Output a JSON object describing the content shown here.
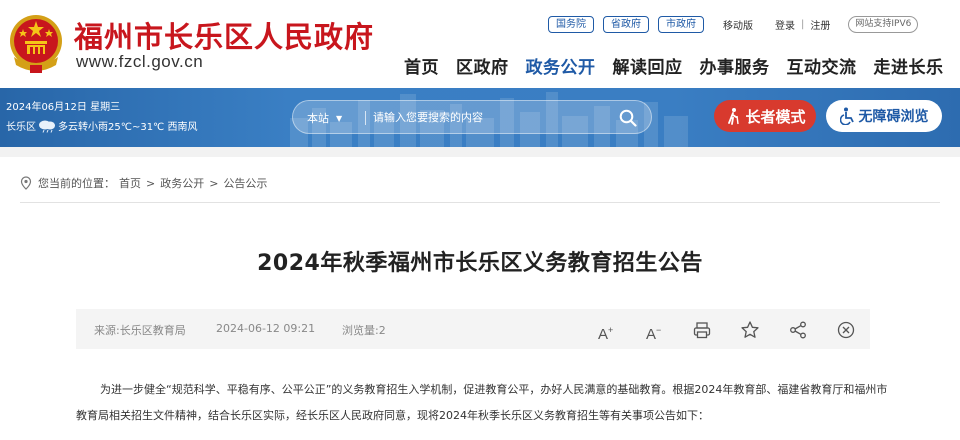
{
  "header": {
    "site_title": "福州市长乐区人民政府",
    "site_domain": "www.fzcl.gov.cn",
    "top_links": [
      "国务院",
      "省政府",
      "市政府"
    ],
    "mobile_label": "移动版",
    "login_label": "登录",
    "separator": "|",
    "register_label": "注册",
    "ipv6_badge": "网站支持IPV6",
    "nav": [
      {
        "label": "首页",
        "active": false
      },
      {
        "label": "区政府",
        "active": false
      },
      {
        "label": "政务公开",
        "active": true
      },
      {
        "label": "解读回应",
        "active": false
      },
      {
        "label": "办事服务",
        "active": false
      },
      {
        "label": "互动交流",
        "active": false
      },
      {
        "label": "走进长乐",
        "active": false
      }
    ]
  },
  "banner": {
    "date": "2024年06月12日 星期三",
    "district": "长乐区",
    "weather_icon": "cloud-rain-icon",
    "weather": "多云转小雨25℃~31℃ 西南风",
    "search_scope": "本站",
    "search_placeholder": "请输入您要搜索的内容",
    "elder_mode_label": "长者模式",
    "accessibility_label": "无障碍浏览"
  },
  "breadcrumb": {
    "prefix": "您当前的位置：",
    "items": [
      "首页",
      "政务公开",
      "公告公示"
    ],
    "separator": ">"
  },
  "article": {
    "title": "2024年秋季福州市长乐区义务教育招生公告",
    "source": "来源:长乐区教育局",
    "date": "2024-06-12 09:21",
    "views": "浏览量:2",
    "tools": [
      "font-increase-icon",
      "font-decrease-icon",
      "print-icon",
      "favorite-star-icon",
      "share-icon",
      "close-icon"
    ],
    "body": "为进一步健全“规范科学、平稳有序、公平公正”的义务教育招生入学机制，促进教育公平，办好人民满意的基础教育。根据2024年教育部、福建省教育厅和福州市教育局相关招生文件精神，结合长乐区实际，经长乐区人民政府同意，现将2024年秋季长乐区义务教育招生等有关事项公告如下："
  },
  "colors": {
    "brand_red": "#c8161d",
    "nav_blue": "#1f5aa6",
    "banner_blue": "#3a7ec3",
    "elder_button": "#d83a2e"
  }
}
